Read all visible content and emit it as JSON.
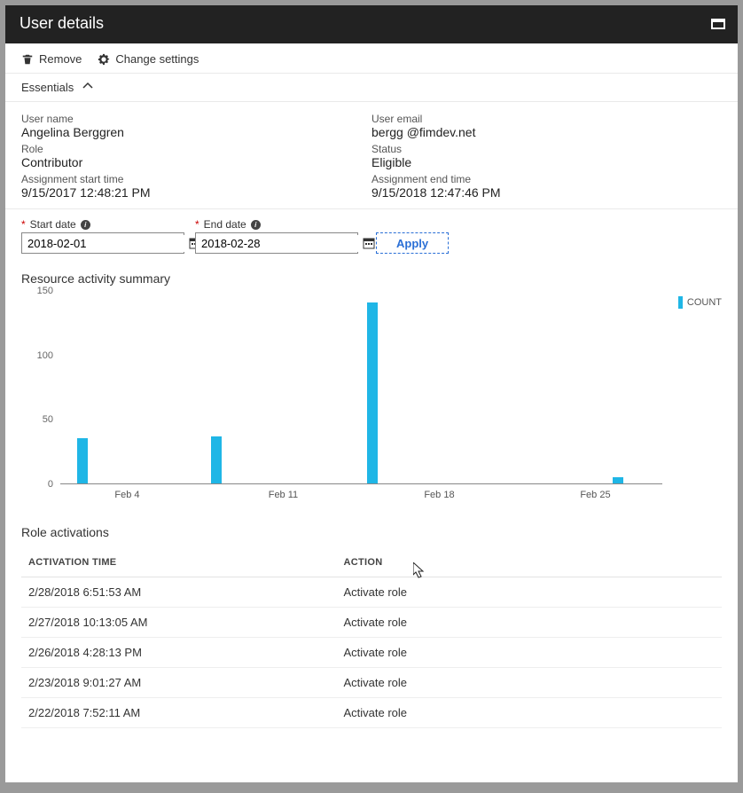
{
  "header": {
    "title": "User details"
  },
  "toolbar": {
    "remove_label": "Remove",
    "settings_label": "Change settings"
  },
  "essentials": {
    "heading": "Essentials",
    "left": {
      "username_label": "User name",
      "username": "Angelina Berggren",
      "role_label": "Role",
      "role": "Contributor",
      "start_label": "Assignment start time",
      "start": "9/15/2017 12:48:21 PM"
    },
    "right": {
      "email_label": "User email",
      "email": "bergg @fimdev.net",
      "status_label": "Status",
      "status": "Eligible",
      "end_label": "Assignment end time",
      "end": "9/15/2018 12:47:46 PM"
    }
  },
  "filters": {
    "start_label": "Start date",
    "start_value": "2018-02-01",
    "end_label": "End date",
    "end_value": "2018-02-28",
    "apply_label": "Apply"
  },
  "chart": {
    "title": "Resource activity summary",
    "legend": "COUNT"
  },
  "chart_data": {
    "type": "bar",
    "title": "Resource activity summary",
    "xlabel": "",
    "ylabel": "",
    "ylim": [
      0,
      150
    ],
    "categories": [
      "Feb 2",
      "Feb 8",
      "Feb 15",
      "Feb 26"
    ],
    "values": [
      36,
      38,
      145,
      5
    ],
    "x_tick_labels": [
      "Feb 4",
      "Feb 11",
      "Feb 18",
      "Feb 25"
    ],
    "y_tick_labels": [
      0,
      50,
      100,
      150
    ],
    "series": [
      {
        "name": "COUNT",
        "values": [
          36,
          38,
          145,
          5
        ]
      }
    ]
  },
  "activations": {
    "title": "Role activations",
    "columns": {
      "time": "ACTIVATION TIME",
      "action": "ACTION"
    },
    "rows": [
      {
        "time": "2/28/2018 6:51:53 AM",
        "action": "Activate role"
      },
      {
        "time": "2/27/2018 10:13:05 AM",
        "action": "Activate role"
      },
      {
        "time": "2/26/2018 4:28:13 PM",
        "action": "Activate role"
      },
      {
        "time": "2/23/2018 9:01:27 AM",
        "action": "Activate role"
      },
      {
        "time": "2/22/2018 7:52:11 AM",
        "action": "Activate role"
      }
    ]
  }
}
